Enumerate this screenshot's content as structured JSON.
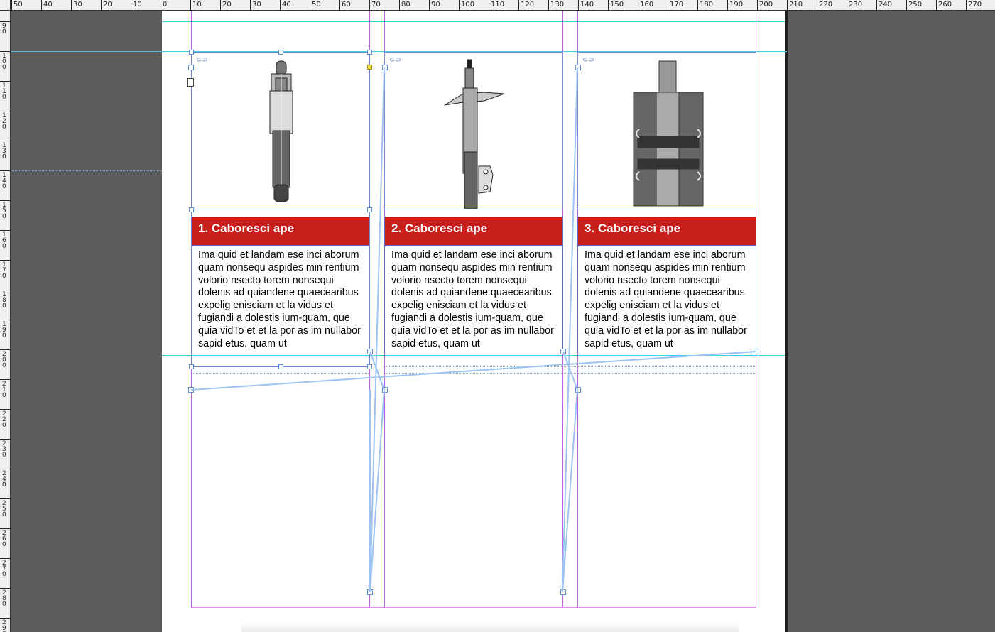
{
  "ruler": {
    "h_labels": [
      "50",
      "40",
      "30",
      "20",
      "10",
      "0",
      "10",
      "20",
      "30",
      "40",
      "50",
      "60",
      "70",
      "80",
      "90",
      "100",
      "110",
      "120",
      "130",
      "140",
      "150",
      "160",
      "170",
      "180",
      "190",
      "200",
      "210",
      "220",
      "230",
      "240",
      "250",
      "260",
      "270"
    ],
    "v_labels": [
      "90",
      "100",
      "110",
      "120",
      "130",
      "140",
      "150",
      "160",
      "170",
      "180",
      "190",
      "200",
      "210",
      "220",
      "230",
      "240",
      "250",
      "260",
      "270",
      "280",
      "290"
    ]
  },
  "cards": [
    {
      "image_icon": "shock-absorber-image",
      "title": "1. Caboresci ape",
      "body": "Ima quid et landam ese inci aborum quam nonsequ aspides min rentium volorio nsecto torem nonsequi dolenis ad quiandene quaecearibus expelig enisciam et la vidus et fugiandi a dolestis ium-quam, que quia vidTo et et la por as im nullabor sapid etus, quam ut"
    },
    {
      "image_icon": "strut-assembly-image",
      "title": "2. Caboresci ape",
      "body": "Ima quid et landam ese inci aborum quam nonsequ aspides min rentium volorio nsecto torem nonsequi dolenis ad quiandene quaecearibus expelig enisciam et la vidus et fugiandi a dolestis ium-quam, que quia vidTo et et la por as im nullabor sapid etus, quam ut"
    },
    {
      "image_icon": "cutaway-valve-image",
      "title": "3. Caboresci ape",
      "body": "Ima quid et landam ese inci aborum quam nonsequ aspides min rentium volorio nsecto torem nonsequi dolenis ad quiandene quaecearibus expelig enisciam et la vidus et fugiandi a dolestis ium-quam, que quia vidTo et et la por as im nullabor sapid etus, quam ut"
    }
  ],
  "colors": {
    "title_bar": "#c81f1b",
    "guide": "#34d6e0",
    "column_guide": "#c05ee6",
    "frame": "#6b7fd0"
  }
}
